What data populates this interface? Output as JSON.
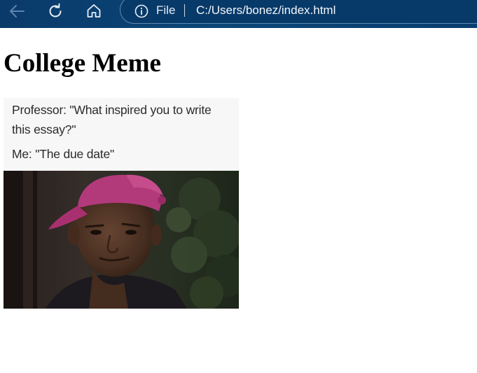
{
  "browser": {
    "back_icon": "arrow-left-icon",
    "reload_icon": "reload-icon",
    "home_icon": "home-icon",
    "info_icon": "info-icon",
    "file_label": "File",
    "url": "C:/Users/bonez/index.html",
    "toolbar_color": "#0b4677"
  },
  "page": {
    "heading": "College Meme",
    "meme": {
      "caption_lines": [
        "Professor: \"What inspired you to write",
        "this essay?\"",
        "Me: \"The due date\""
      ]
    }
  }
}
